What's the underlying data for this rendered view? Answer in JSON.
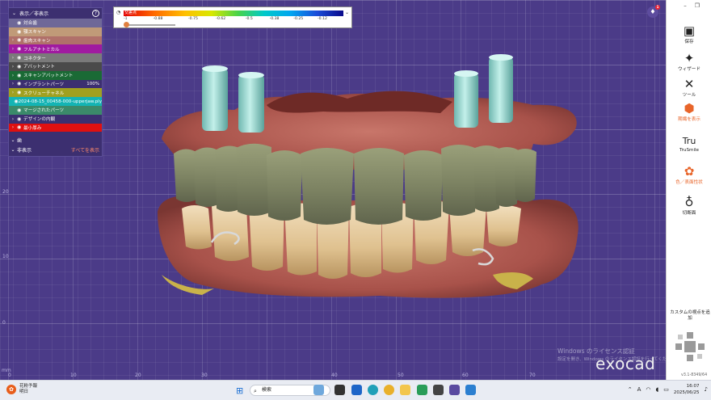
{
  "panel": {
    "header": "表示／非表示",
    "rows": [
      {
        "label": "対合歯",
        "color": "#6f6898",
        "arrow": "",
        "eye": true
      },
      {
        "label": "顎スキャン",
        "color": "#c09a78",
        "arrow": "",
        "eye": true
      },
      {
        "label": "歯肉スキャン",
        "color": "#b0706a",
        "arrow": "›",
        "eye": true
      },
      {
        "label": "フルアナトミカル",
        "color": "#a01aa0",
        "arrow": "›",
        "eye": true
      },
      {
        "label": "コネクター",
        "color": "#7a7a7a",
        "arrow": "›",
        "eye": true
      },
      {
        "label": "アバットメント",
        "color": "#4a4a4a",
        "arrow": "›",
        "eye": true
      },
      {
        "label": "スキャンアバットメント",
        "color": "#1a6a35",
        "arrow": "›",
        "eye": true
      },
      {
        "label": "インプラントパーツ",
        "color": "#3c2f70",
        "arrow": "›",
        "eye": true,
        "pct": "100%"
      },
      {
        "label": "スクリューチャネル",
        "color": "#a0a020",
        "arrow": "›",
        "eye": true
      },
      {
        "label": "2024-08-15_00458-000-upperjaw.ply",
        "color": "#14b4b4",
        "arrow": "",
        "eye": true
      },
      {
        "label": "マージされたパーツ",
        "color": "#3b8a6a",
        "arrow": "",
        "eye": true
      },
      {
        "label": "デザインの内観",
        "color": "#3c2f70",
        "arrow": "›",
        "eye": true
      },
      {
        "label": "最小厚み",
        "color": "#e01010",
        "arrow": "›",
        "eye": true
      }
    ],
    "tooth_label": "歯",
    "hidden_label": "非表示",
    "show_all": "すべてを表示"
  },
  "colorbar": {
    "tag": "交差点",
    "ticks": [
      "-1",
      "-0.88",
      "-0.75",
      "-0.62",
      "-0.5",
      "-0.38",
      "-0.25",
      "-0.12"
    ]
  },
  "toolbar": {
    "tools": [
      {
        "label": "保存",
        "icon": "save-icon",
        "glyph": "▣",
        "orange": false
      },
      {
        "label": "ウィザード",
        "icon": "wand-icon",
        "glyph": "✦",
        "orange": false
      },
      {
        "label": "ツール",
        "icon": "tools-icon",
        "glyph": "✕",
        "orange": false
      },
      {
        "label": "期繊を表示",
        "icon": "teeth-display-icon",
        "glyph": "⬢",
        "orange": true
      },
      {
        "label": "TruSmile",
        "icon": "trusmile-icon",
        "glyph": "Tru",
        "orange": false
      },
      {
        "label": "色／表面性状",
        "icon": "palette-icon",
        "glyph": "✿",
        "orange": true
      },
      {
        "label": "切断面",
        "icon": "tooth-cut-icon",
        "glyph": "♁",
        "orange": false
      }
    ],
    "custom_view": "カスタムの視点を追加",
    "version": "v3.1-8349/64"
  },
  "watermark": {
    "line1": "Windows のライセンス認証",
    "line2": "設定を開き、Windows のライセンス認証を行ってください。"
  },
  "logo": "exocad",
  "ruler": {
    "bottom": [
      "0",
      "10",
      "20",
      "30",
      "40",
      "50",
      "60",
      "70"
    ],
    "left": [
      "20",
      "10",
      "0"
    ],
    "unit": "mm"
  },
  "notification": {
    "count": "1"
  },
  "taskbar": {
    "weather_title": "花粉予報",
    "weather_sub": "明日",
    "search_placeholder": "検索",
    "time": "16:07",
    "date": "2025/06/25",
    "ime": "A"
  }
}
